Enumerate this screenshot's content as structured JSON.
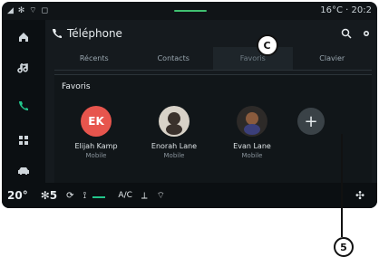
{
  "status": {
    "left_icons": "◢ ✻ ⌔ ◻",
    "temperature": "16°C",
    "time": "20:2"
  },
  "header": {
    "title": "Téléphone",
    "search_icon": "search-icon",
    "settings_icon": "gear-icon"
  },
  "tabs": [
    {
      "label": "Récents"
    },
    {
      "label": "Contacts"
    },
    {
      "label": "Favoris"
    },
    {
      "label": "Clavier"
    }
  ],
  "section": {
    "title": "Favoris"
  },
  "favorites": [
    {
      "name": "Elijah Kamp",
      "type": "Mobile",
      "initials": "EK"
    },
    {
      "name": "Enorah Lane",
      "type": "Mobile"
    },
    {
      "name": "Evan Lane",
      "type": "Mobile"
    }
  ],
  "bottom": {
    "temp_left": "20",
    "temp_left_unit": "°",
    "fan_level": "5",
    "ac_label": "A/C"
  },
  "callouts": {
    "c": "C",
    "five": "5"
  }
}
